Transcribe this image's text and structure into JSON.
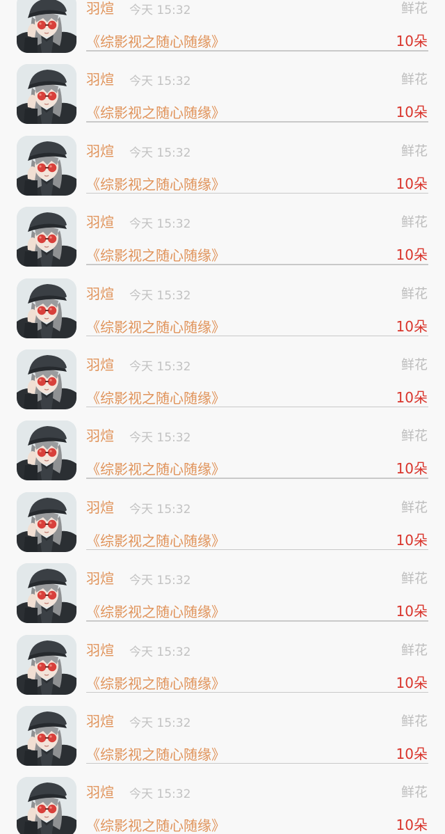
{
  "colors": {
    "name": "#e0935a",
    "time": "#c2c2c2",
    "gift": "#bdbdbd",
    "amount": "#d9342b",
    "divider": "#c9c9c9",
    "background": "#f8f8f8"
  },
  "records": [
    {
      "name": "羽煊",
      "time": "今天 15:32",
      "gift": "鲜花",
      "book": "《综影视之随心随缘》",
      "amount": "10朵",
      "avatar_icon": "avatar-icon"
    },
    {
      "name": "羽煊",
      "time": "今天 15:32",
      "gift": "鲜花",
      "book": "《综影视之随心随缘》",
      "amount": "10朵",
      "avatar_icon": "avatar-icon"
    },
    {
      "name": "羽煊",
      "time": "今天 15:32",
      "gift": "鲜花",
      "book": "《综影视之随心随缘》",
      "amount": "10朵",
      "avatar_icon": "avatar-icon"
    },
    {
      "name": "羽煊",
      "time": "今天 15:32",
      "gift": "鲜花",
      "book": "《综影视之随心随缘》",
      "amount": "10朵",
      "avatar_icon": "avatar-icon"
    },
    {
      "name": "羽煊",
      "time": "今天 15:32",
      "gift": "鲜花",
      "book": "《综影视之随心随缘》",
      "amount": "10朵",
      "avatar_icon": "avatar-icon"
    },
    {
      "name": "羽煊",
      "time": "今天 15:32",
      "gift": "鲜花",
      "book": "《综影视之随心随缘》",
      "amount": "10朵",
      "avatar_icon": "avatar-icon"
    },
    {
      "name": "羽煊",
      "time": "今天 15:32",
      "gift": "鲜花",
      "book": "《综影视之随心随缘》",
      "amount": "10朵",
      "avatar_icon": "avatar-icon"
    },
    {
      "name": "羽煊",
      "time": "今天 15:32",
      "gift": "鲜花",
      "book": "《综影视之随心随缘》",
      "amount": "10朵",
      "avatar_icon": "avatar-icon"
    },
    {
      "name": "羽煊",
      "time": "今天 15:32",
      "gift": "鲜花",
      "book": "《综影视之随心随缘》",
      "amount": "10朵",
      "avatar_icon": "avatar-icon"
    },
    {
      "name": "羽煊",
      "time": "今天 15:32",
      "gift": "鲜花",
      "book": "《综影视之随心随缘》",
      "amount": "10朵",
      "avatar_icon": "avatar-icon"
    },
    {
      "name": "羽煊",
      "time": "今天 15:32",
      "gift": "鲜花",
      "book": "《综影视之随心随缘》",
      "amount": "10朵",
      "avatar_icon": "avatar-icon"
    },
    {
      "name": "羽煊",
      "time": "今天 15:32",
      "gift": "鲜花",
      "book": "《综影视之随心随缘》",
      "amount": "10朵",
      "avatar_icon": "avatar-icon"
    }
  ]
}
